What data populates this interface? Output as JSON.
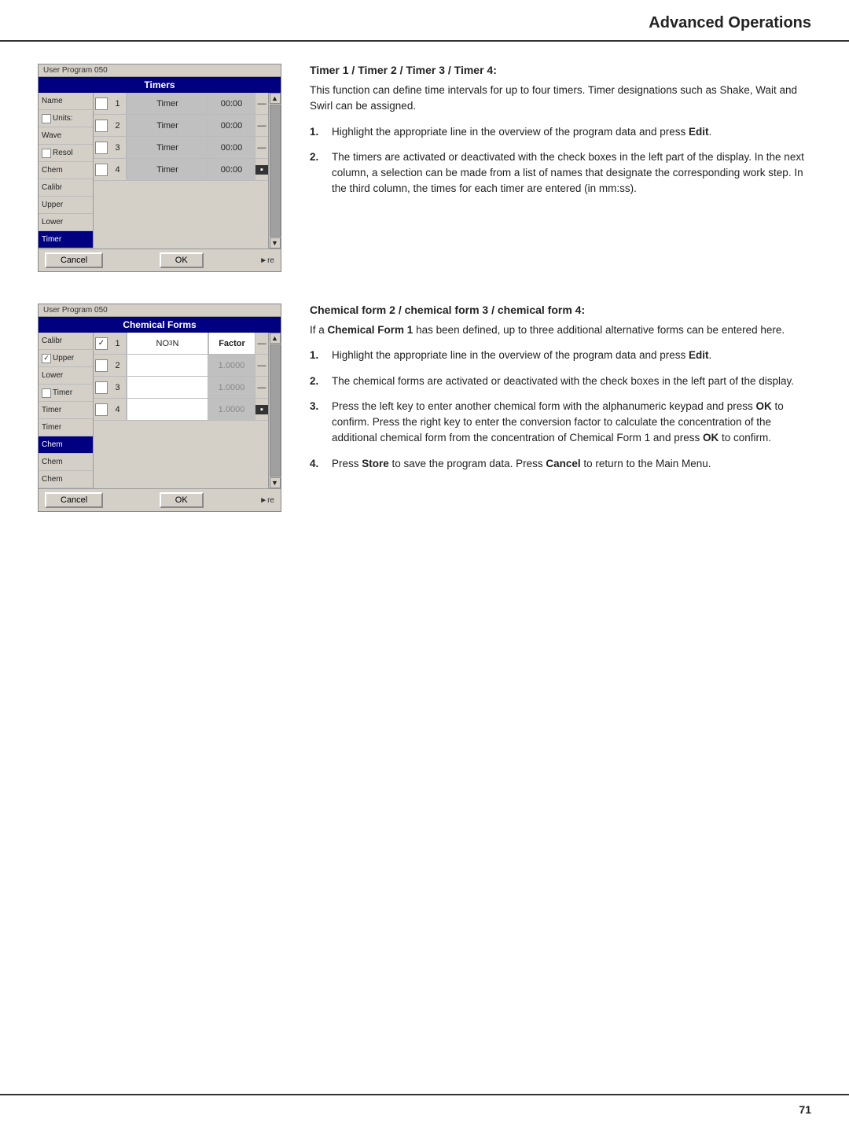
{
  "header": {
    "title": "Advanced Operations"
  },
  "page_number": "71",
  "section1": {
    "panel": {
      "topbar": "User Program  050",
      "title": "Timers",
      "left_items": [
        {
          "label": "Name",
          "highlighted": false
        },
        {
          "label": "Units:",
          "highlighted": false,
          "checkbox": true
        },
        {
          "label": "Wave",
          "highlighted": false
        },
        {
          "label": "Resol",
          "highlighted": false,
          "checkbox": true
        },
        {
          "label": "Chem",
          "highlighted": false
        },
        {
          "label": "Calibr",
          "highlighted": false
        },
        {
          "label": "Upper",
          "highlighted": false
        },
        {
          "label": "Lower",
          "highlighted": false
        },
        {
          "label": "Timer",
          "highlighted": true
        }
      ],
      "timers": [
        {
          "num": "1",
          "label": "Timer",
          "value": "00:00"
        },
        {
          "num": "2",
          "label": "Timer",
          "value": "00:00"
        },
        {
          "num": "3",
          "label": "Timer",
          "value": "00:00"
        },
        {
          "num": "4",
          "label": "Timer",
          "value": "00:00"
        }
      ],
      "cancel_btn": "Cancel",
      "ok_btn": "OK",
      "more_text": "►re"
    },
    "heading": "Timer 1 / Timer 2 / Timer 3 / Timer 4:",
    "intro": "This function can define time intervals for up to four timers. Timer designations such as Shake, Wait and Swirl can be assigned.",
    "steps": [
      {
        "num": "1.",
        "text": "Highlight the appropriate line in the overview of the program data and press Edit."
      },
      {
        "num": "2.",
        "text": "The timers are activated or deactivated with the check boxes in the left part of the display. In the next column, a selection can be made from a list of names that designate the corresponding work step. In the third column, the times for each timer are entered (in mm:ss)."
      }
    ]
  },
  "section2": {
    "panel": {
      "topbar": "User Program  050",
      "title": "Chemical Forms",
      "left_items": [
        {
          "label": "Calibr",
          "highlighted": false
        },
        {
          "label": "Upper",
          "highlighted": false,
          "checkbox": true,
          "checked": true
        },
        {
          "label": "Lower",
          "highlighted": false
        },
        {
          "label": "Timer",
          "highlighted": false,
          "checkbox": true
        },
        {
          "label": "Timer",
          "highlighted": false
        },
        {
          "label": "Timer",
          "highlighted": false
        },
        {
          "label": "Chem",
          "highlighted": true
        },
        {
          "label": "Chem",
          "highlighted": false
        },
        {
          "label": "Chem",
          "highlighted": false
        }
      ],
      "chem_rows": [
        {
          "num": "1",
          "checked": true,
          "formula": "NO₃N",
          "factor": "Factor",
          "factor_active": true
        },
        {
          "num": "2",
          "checked": false,
          "formula": "",
          "factor": "1.0000",
          "factor_active": false
        },
        {
          "num": "3",
          "checked": false,
          "formula": "",
          "factor": "1.0000",
          "factor_active": false
        },
        {
          "num": "4",
          "checked": false,
          "formula": "",
          "factor": "1.0000",
          "factor_active": false
        }
      ],
      "cancel_btn": "Cancel",
      "ok_btn": "OK",
      "more_text": "►re"
    },
    "heading": "Chemical form 2 / chemical form 3 / chemical form 4:",
    "intro": "If a Chemical Form 1 has been defined, up to three additional alternative forms can be entered here.",
    "steps": [
      {
        "num": "1.",
        "text": "Highlight the appropriate line in the overview of the program data and press Edit."
      },
      {
        "num": "2.",
        "text": "The chemical forms are activated or deactivated with the check boxes in the left part of the display."
      },
      {
        "num": "3.",
        "text": "Press the left key to enter another chemical form with the alphanumeric keypad and press OK to confirm. Press the right key to enter the conversion factor to calculate the concentration of the additional chemical form from the concentration of Chemical Form 1 and press OK to confirm."
      },
      {
        "num": "4.",
        "text": "Press Store to save the program data. Press Cancel to return to the Main Menu."
      }
    ]
  }
}
